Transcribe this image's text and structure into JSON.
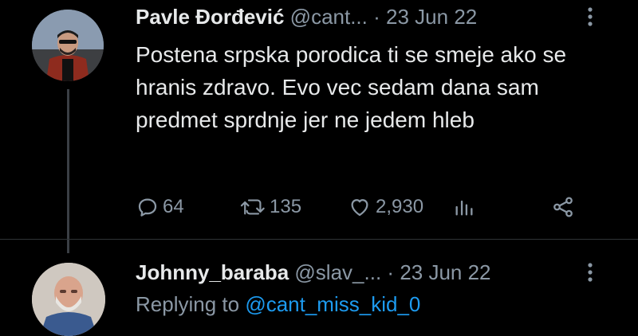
{
  "tweets": [
    {
      "name": "Pavle Đorđević",
      "handle": "@cant...",
      "separator": "·",
      "date": "23 Jun 22",
      "text": "Postena srpska porodica ti se smeje ako se hranis zdravo. Evo vec sedam dana sam predmet sprdnje jer ne jedem hleb",
      "stats": {
        "replies": "64",
        "retweets": "135",
        "likes": "2,930"
      }
    },
    {
      "name": "Johnny_baraba",
      "handle": "@slav_...",
      "separator": "·",
      "date": "23 Jun 22",
      "replying_prefix": "Replying to",
      "replying_to": "@cant_miss_kid_0"
    }
  ],
  "icons": {
    "reply": "reply-icon",
    "retweet": "retweet-icon",
    "like": "heart-icon",
    "views": "views-icon",
    "share": "share-icon",
    "more": "more-icon"
  },
  "colors": {
    "background": "#000000",
    "text": "#e7e9ea",
    "muted": "#8b98a5",
    "link": "#1d9bf0"
  }
}
